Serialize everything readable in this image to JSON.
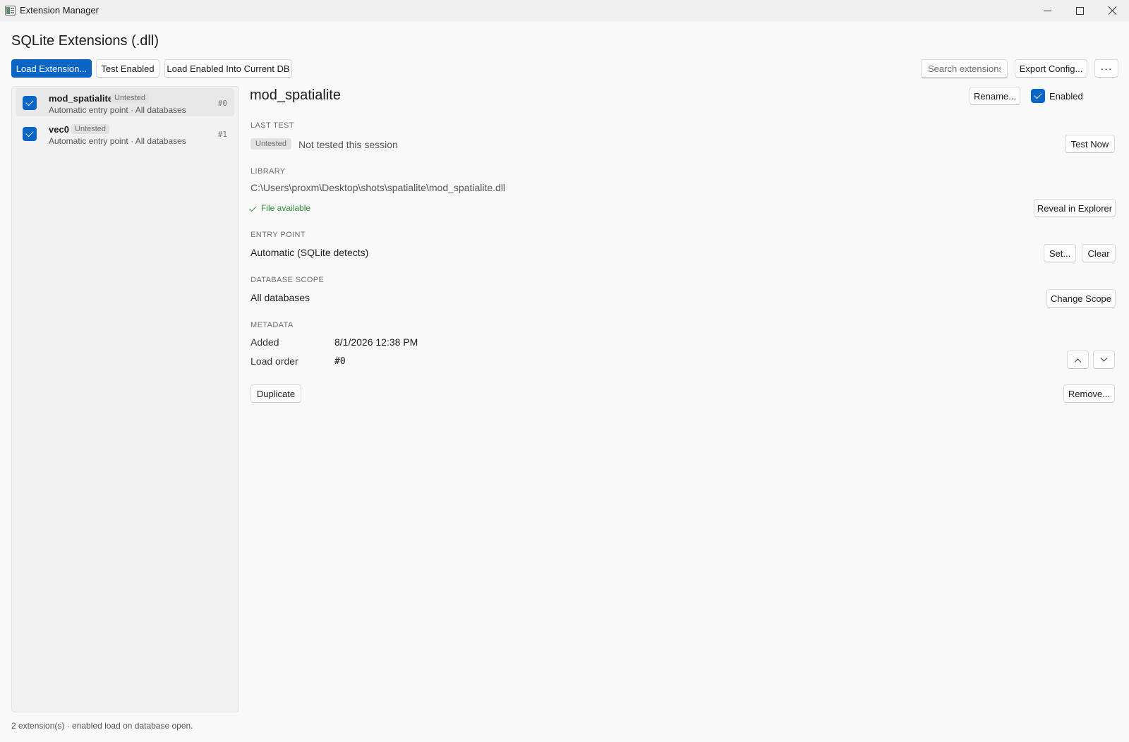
{
  "window": {
    "title": "Extension Manager",
    "app_icon": "window-app-icon",
    "controls": [
      "minimize-icon",
      "maximize-icon",
      "close-icon"
    ]
  },
  "header": {
    "title": "SQLite Extensions (.dll)"
  },
  "toolbar": {
    "load_extension": "Load Extension...",
    "test_enabled": "Test Enabled",
    "load_enabled_into_db": "Load Enabled Into Current DB",
    "search_placeholder": "Search extensions...",
    "export_config": "Export Config...",
    "more": "···"
  },
  "extensions": [
    {
      "name": "mod_spatialite",
      "status": "Untested",
      "entry": "Automatic entry point",
      "scope": "All databases",
      "order": "#0",
      "enabled": true,
      "selected": true
    },
    {
      "name": "vec0",
      "status": "Untested",
      "entry": "Automatic entry point",
      "scope": "All databases",
      "order": "#1",
      "enabled": true,
      "selected": false
    }
  ],
  "detail": {
    "title": "mod_spatialite",
    "rename": "Rename...",
    "enabled_label": "Enabled",
    "last_test": {
      "label": "LAST TEST",
      "badge": "Untested",
      "text": "Not tested this session",
      "button": "Test Now"
    },
    "library": {
      "label": "LIBRARY",
      "path": "C:\\Users\\proxm\\Desktop\\shots\\spatialite\\mod_spatialite.dll",
      "status": "File available",
      "button": "Reveal in Explorer"
    },
    "entry_point": {
      "label": "ENTRY POINT",
      "value": "Automatic (SQLite detects)",
      "set_button": "Set...",
      "clear_button": "Clear"
    },
    "database_scope": {
      "label": "DATABASE SCOPE",
      "value": "All databases",
      "button": "Change Scope"
    },
    "metadata": {
      "label": "METADATA",
      "added_key": "Added",
      "added_value": "8/1/2026 12:38 PM",
      "order_key": "Load order",
      "order_value": "#0"
    },
    "duplicate": "Duplicate",
    "remove": "Remove..."
  },
  "footer": {
    "text": "2 extension(s) · enabled load on database open."
  },
  "colors": {
    "accent": "#0a66c6",
    "success": "#2e8b3a",
    "badge_bg": "#e2e2e2"
  }
}
